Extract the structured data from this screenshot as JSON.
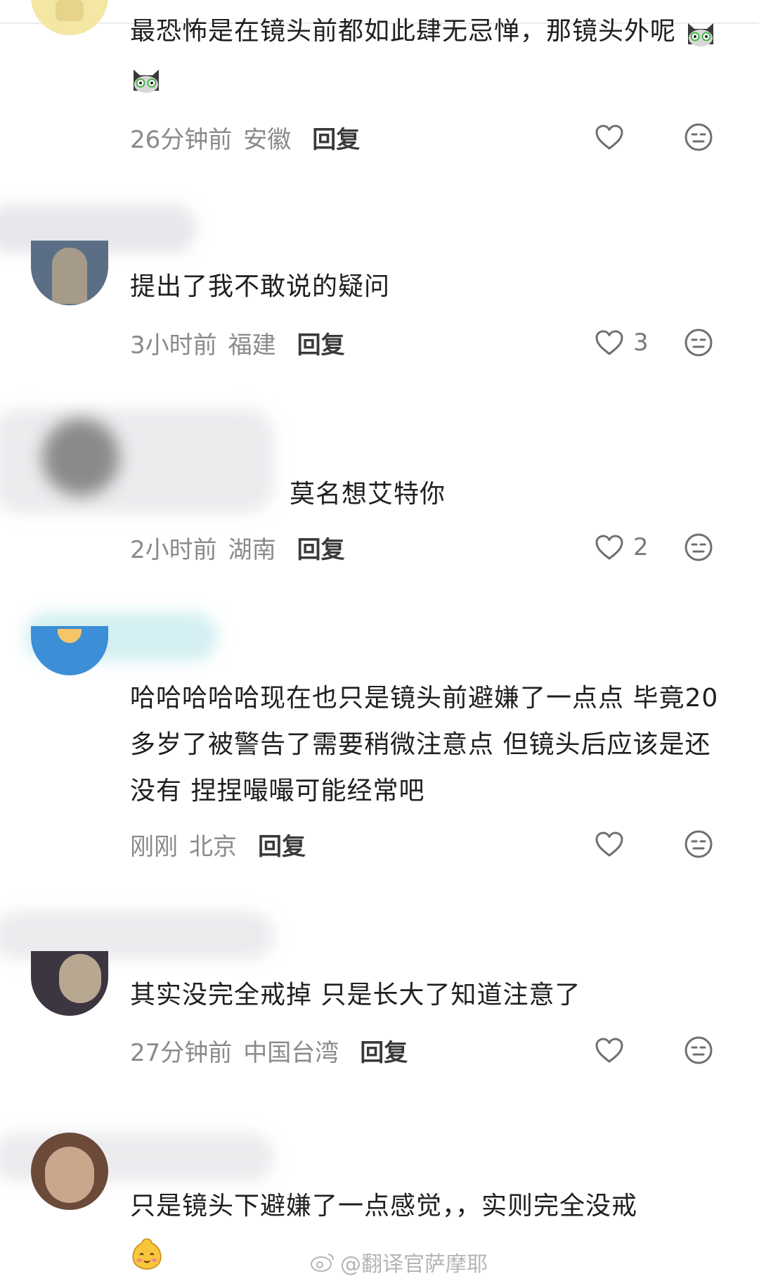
{
  "comments": [
    {
      "text": "最恐怖是在镜头前都如此肆无忌惮，那镜头外呢",
      "time": "26分钟前",
      "location": "安徽",
      "reply_label": "回复",
      "likes": ""
    },
    {
      "text": "提出了我不敢说的疑问",
      "time": "3小时前",
      "location": "福建",
      "reply_label": "回复",
      "likes": "3"
    },
    {
      "text": "莫名想艾特你",
      "time": "2小时前",
      "location": "湖南",
      "reply_label": "回复",
      "likes": "2"
    },
    {
      "text": "哈哈哈哈哈现在也只是镜头前避嫌了一点点 毕竟20多岁了被警告了需要稍微注意点 但镜头后应该是还没有 捏捏嘬嘬可能经常吧",
      "time": "刚刚",
      "location": "北京",
      "reply_label": "回复",
      "likes": ""
    },
    {
      "text": "其实没完全戒掉 只是长大了知道注意了",
      "time": "27分钟前",
      "location": "中国台湾",
      "reply_label": "回复",
      "likes": ""
    },
    {
      "text": "只是镜头下避嫌了一点感觉，，实则完全没戒",
      "time": "",
      "location": "",
      "reply_label": "",
      "likes": ""
    }
  ],
  "watermark": "@翻译官萨摩耶",
  "icons": {
    "like": "heart-outline-icon",
    "dislike": "neutral-face-icon",
    "cat_emoji": "cat-face-emoji",
    "smile_emoji": "blushing-face-emoji",
    "weibo_logo": "weibo-eye-icon"
  },
  "colors": {
    "text": "#1f1f1f",
    "meta": "#8a8a8a",
    "reply": "#3a3a3a",
    "icon": "#6f6f6f"
  }
}
